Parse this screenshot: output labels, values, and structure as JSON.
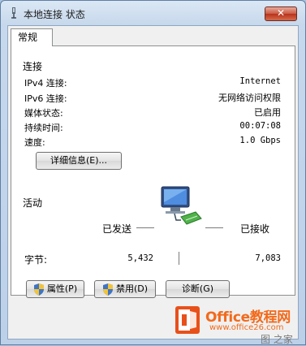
{
  "window": {
    "title": "本地连接 状态",
    "close_label": "✕"
  },
  "tabs": [
    {
      "label": "常规"
    }
  ],
  "connection": {
    "title": "连接",
    "rows": [
      {
        "label": "IPv4 连接:",
        "value": "Internet"
      },
      {
        "label": "IPv6 连接:",
        "value": "无网络访问权限"
      },
      {
        "label": "媒体状态:",
        "value": "已启用"
      },
      {
        "label": "持续时间:",
        "value": "00:07:08"
      },
      {
        "label": "速度:",
        "value": "1.0 Gbps"
      }
    ],
    "details_button": "详细信息(E)..."
  },
  "activity": {
    "title": "活动",
    "sent_label": "已发送",
    "received_label": "已接收",
    "bytes_label": "字节:",
    "bytes_sent": "5,432",
    "bytes_received": "7,083"
  },
  "buttons": {
    "properties": "属性(P)",
    "disable": "禁用(D)",
    "diagnose": "诊断(G)"
  },
  "watermark": {
    "title": "Office教程网",
    "url": "www.office26.com",
    "extra": "图 之家"
  },
  "colors": {
    "accent_orange": "#f26a1b",
    "close_red": "#c95a44",
    "shield_blue": "#3f74c4",
    "shield_yellow": "#f3c43a"
  }
}
